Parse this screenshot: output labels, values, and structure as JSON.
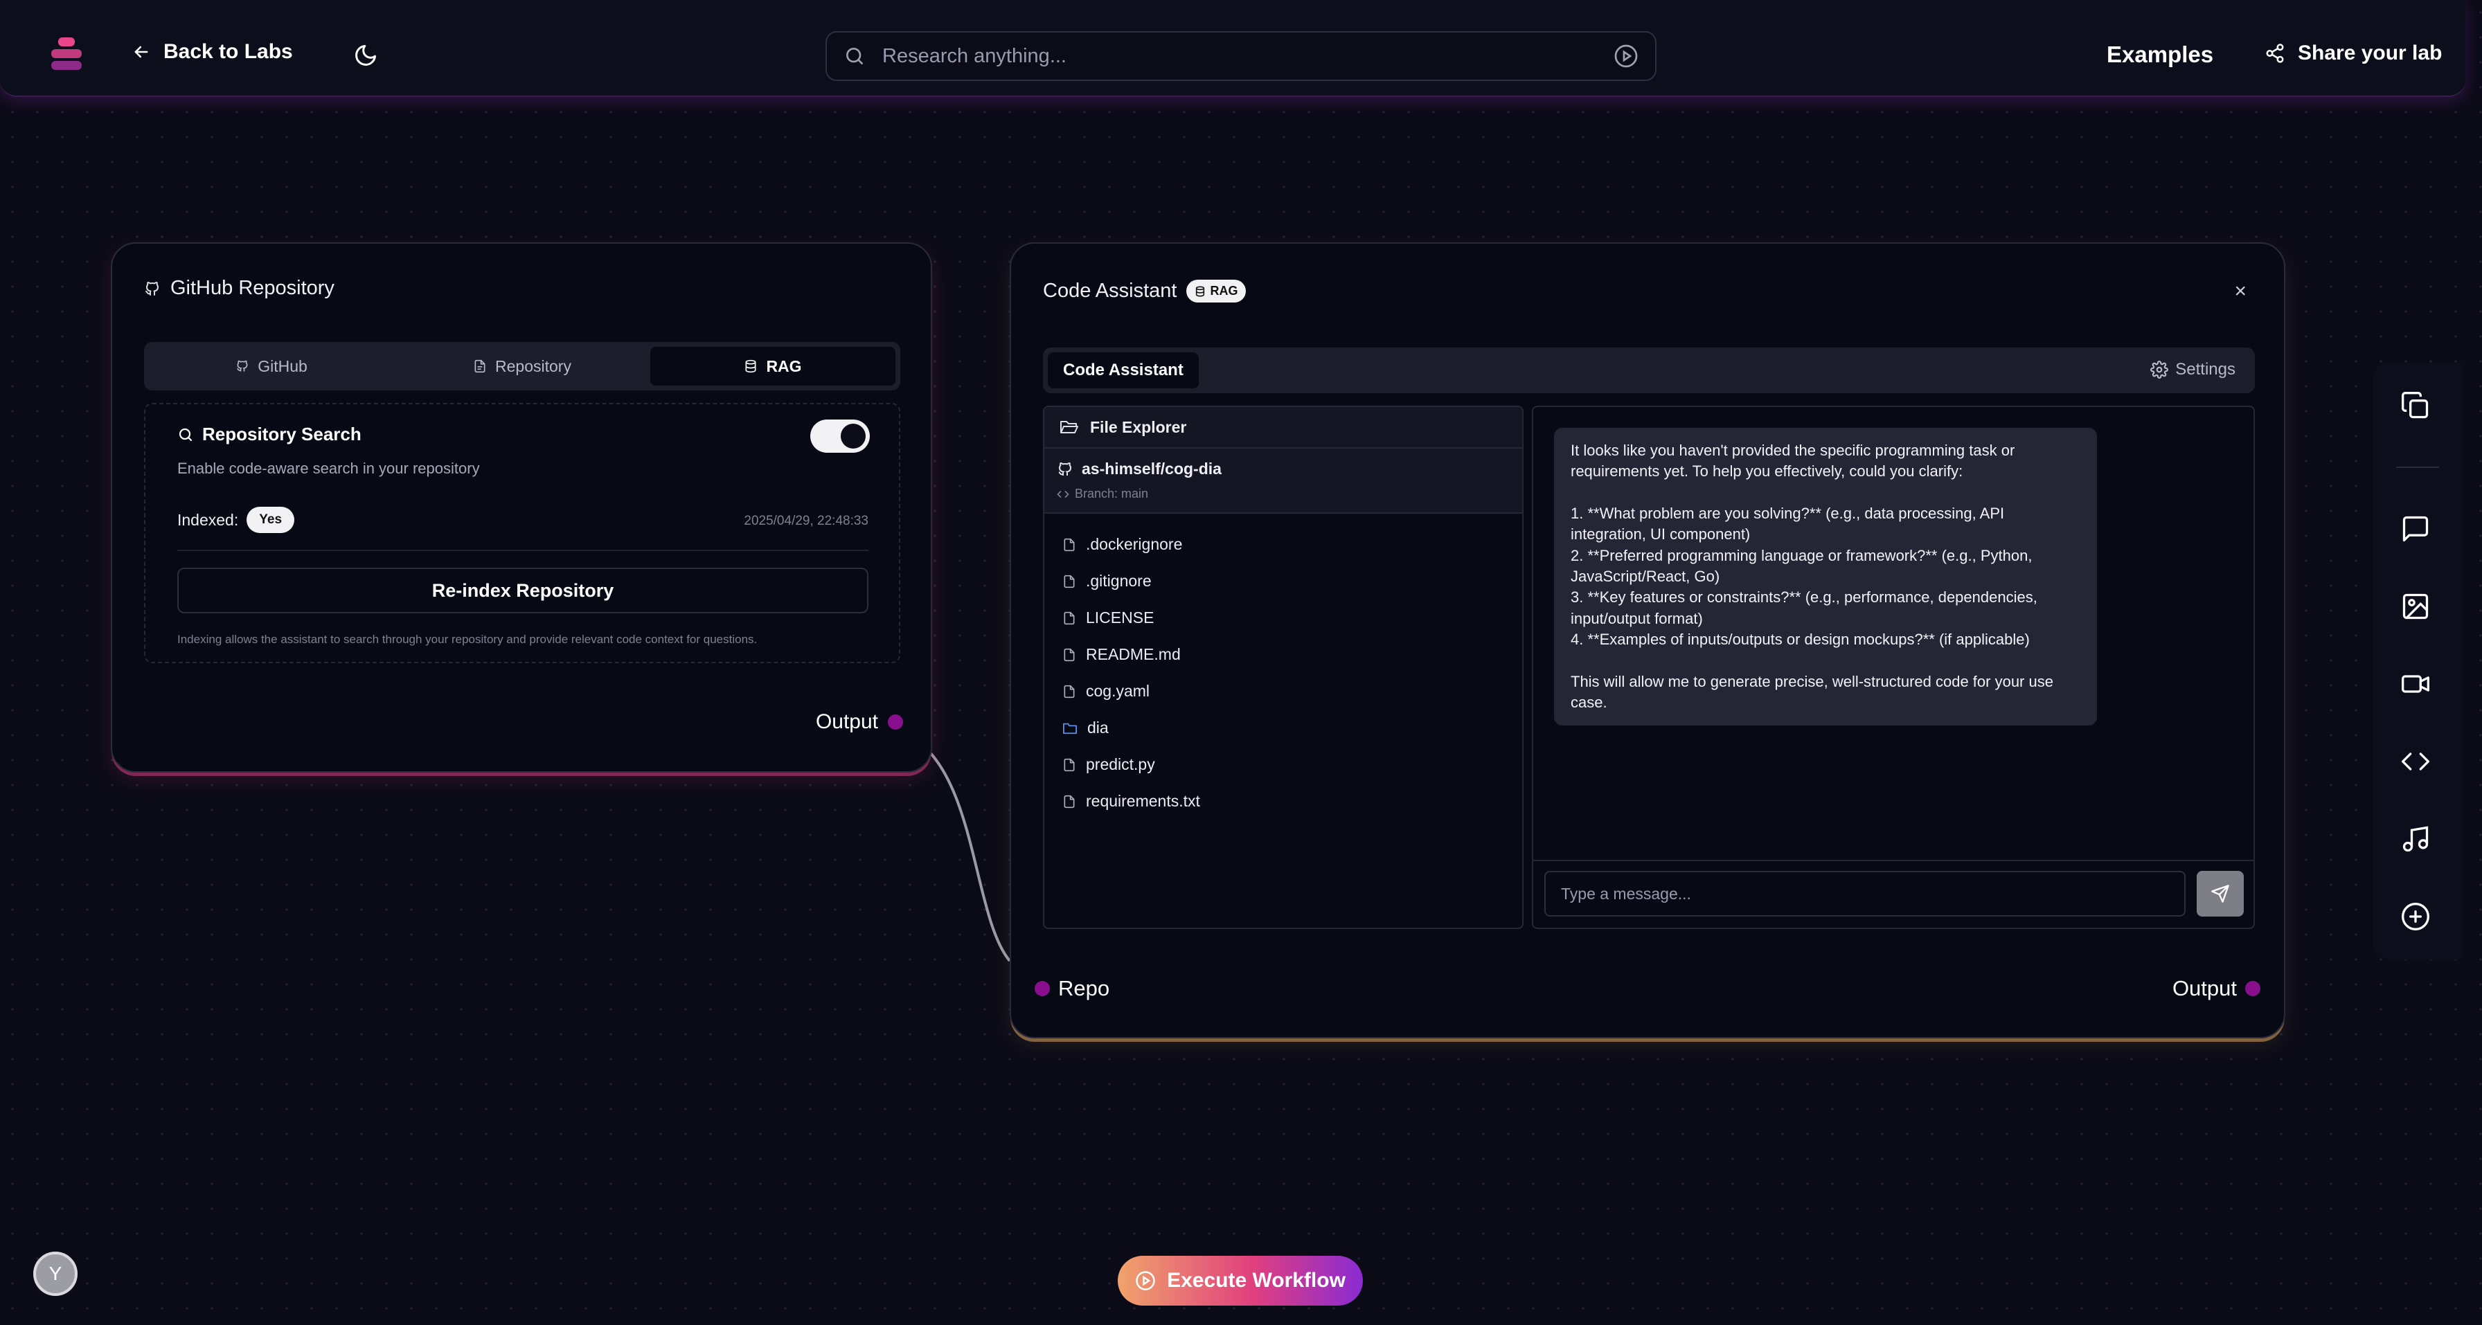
{
  "topbar": {
    "back_label": "Back to Labs",
    "search_placeholder": "Research anything...",
    "examples_label": "Examples",
    "share_label": "Share your lab"
  },
  "github_card": {
    "title": "GitHub Repository",
    "tabs": [
      {
        "label": "GitHub",
        "icon": "github-icon",
        "active": false
      },
      {
        "label": "Repository",
        "icon": "file-icon",
        "active": false
      },
      {
        "label": "RAG",
        "icon": "database-icon",
        "active": true
      }
    ],
    "rag": {
      "heading": "Repository Search",
      "description": "Enable code-aware search in your repository",
      "toggle_on": true,
      "indexed_label": "Indexed:",
      "indexed_value": "Yes",
      "indexed_at": "2025/04/29, 22:48:33",
      "reindex_label": "Re-index Repository",
      "note": "Indexing allows the assistant to search through your repository and provide relevant code context for questions."
    },
    "output_label": "Output"
  },
  "assistant_card": {
    "title": "Code Assistant",
    "badge": "RAG",
    "close_label": "×",
    "tab_label": "Code Assistant",
    "settings_label": "Settings",
    "explorer": {
      "header": "File Explorer",
      "repo_name": "as-himself/cog-dia",
      "branch": "Branch: main",
      "files": [
        {
          "name": ".dockerignore",
          "type": "file"
        },
        {
          "name": ".gitignore",
          "type": "file"
        },
        {
          "name": "LICENSE",
          "type": "file"
        },
        {
          "name": "README.md",
          "type": "file"
        },
        {
          "name": "cog.yaml",
          "type": "file"
        },
        {
          "name": "dia",
          "type": "folder"
        },
        {
          "name": "predict.py",
          "type": "file"
        },
        {
          "name": "requirements.txt",
          "type": "file"
        }
      ]
    },
    "chat": {
      "message": {
        "intro": "It looks like you haven't provided the specific programming task or requirements yet. To help you effectively, could you clarify:",
        "items": [
          "1. **What problem are you solving?** (e.g., data processing, API integration, UI component)",
          "2. **Preferred programming language or framework?** (e.g., Python, JavaScript/React, Go)",
          "3. **Key features or constraints?** (e.g., performance, dependencies, input/output format)",
          "4. **Examples of inputs/outputs or design mockups?** (if applicable)"
        ],
        "outro": "This will allow me to generate precise, well-structured code for your use case."
      },
      "input_placeholder": "Type a message..."
    },
    "input_port_label": "Repo",
    "output_label": "Output"
  },
  "sidebar_tools": [
    "copy-icon",
    "chat-icon",
    "image-icon",
    "video-icon",
    "code-icon",
    "music-icon",
    "add-icon"
  ],
  "execute_label": "Execute Workflow",
  "avatar_initial": "Y",
  "colors": {
    "background": "#0b0b17",
    "port": "#8a0f8f",
    "execute_gradient_start": "#f0a36b",
    "execute_gradient_end": "#8a2bd2"
  }
}
